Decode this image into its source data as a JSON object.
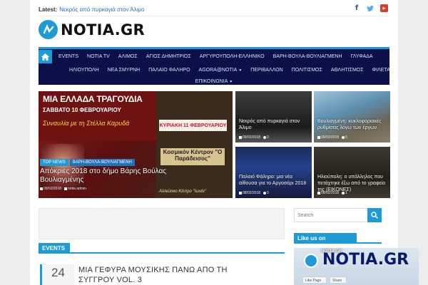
{
  "topbar": {
    "latest_label": "Latest:",
    "latest_link": "Νεκρός από πυρκαγιά στον Άλιμο",
    "social": [
      "facebook-icon",
      "twitter-icon",
      "youtube-icon"
    ]
  },
  "logo": {
    "text": "NOTIA.GR"
  },
  "nav": {
    "row1": [
      "EVENTS",
      "NOTIA TV",
      "ΑΛΙΜΟΣ",
      "ΑΓΙΟΣ ΔΗΜΗΤΡΙΟΣ",
      "ΑΡΓΥΡΟΥΠΟΛΗ-ΕΛΛΗΝΙΚΟ",
      "ΒΑΡΗ-ΒΟΥΛΑ-ΒΟΥΛΙΑΓΜΕΝΗ",
      "ΓΛΥΦΑΔΑ"
    ],
    "row2": [
      "ΗΛΙΟΥΠΟΛΗ",
      "ΝΕΑ ΣΜΥΡΝΗ",
      "ΠΑΛΑΙΟ ΦΑΛΗΡΟ",
      "AGORA@NOTIA",
      "ΠΕΡΙΒΑΛΛΟΝ",
      "ΠΟΛΙΤΙΣΜΟΣ",
      "ΑΘΛΗΤΙΣΜΟΣ",
      "ΦΙΛΕΤΑ"
    ],
    "row3": [
      "ΕΠΙΚΟΙΝΩΝΙΑ"
    ]
  },
  "featured": {
    "banner_heading": "ΜΙΑ ΕΛΛΑΔΑ ΤΡΑΓΟΥΔΙΑ",
    "banner_date": "ΣΑΒΒΑΤΟ 10 ΦΕΒΡΟΥΑΡΙΟΥ",
    "banner_sub": "Συναυλία με τη Στέλλα Καρυδά",
    "poster_date": "ΚΥΡΙΑΚΗ 11 ΦΕΒΡΟΥΑΡΙΟΥ",
    "poster_title": "Κοσμικόν Κέντρον \"Ο Παράδεισος\"",
    "poster_bottom": "Αλλιώτικο Κέντρο \"Ιωνία\"",
    "cat1": "TOP NEWS",
    "cat2": "ΒΑΡΗ-ΒΟΥΛΑ-ΒΟΥΛΙΑΓΜΕΝΗ",
    "title": "Απόκριες 2018 στο δήμο Βάρης Βούλας Βουλιαγμένης",
    "date": "09/02/2018",
    "author": "notia admin"
  },
  "small_posts": [
    {
      "title": "Νεκρός από πυρκαγιά στον Άλιμο",
      "date": "09/02/2018",
      "comments": "0"
    },
    {
      "title": "Βουλιαγμένη: κυκλοφοριακές ρυθμίσεις λόγω των έργων",
      "date": "09/02/2018",
      "comments": "0"
    },
    {
      "title": "Παλαιό Φάληρο: μια νέα αίθουσα για το Αργοσάρι 2018",
      "date": "08/02/2018",
      "comments": "0"
    },
    {
      "title": "Ηλιούπολη: ο υπάλληλος που πετάχτηκε έξω από το γραφείο της (ΕΙΚΟΝΕΣ)",
      "date": "08/02/2018",
      "comments": "1"
    }
  ],
  "sidebar": {
    "search_placeholder": "Search",
    "fb_heading": "Like us on Facebook",
    "fb_page_name": "NOTIA.GR",
    "fb_like": "Like Page",
    "fb_share": "Share"
  },
  "events": {
    "heading": "EVENTS",
    "day": "24",
    "title": "ΜΙΑ ΓΕΦΥΡΑ ΜΟΥΣΙΚΗΣ ΠΑΝΩ ΑΠΟ ΤΗ ΣΥΓΓΡΟΥ VOL. 3"
  },
  "colors": {
    "accent": "#1e9ad6",
    "nav_bg": "#0b1048"
  }
}
